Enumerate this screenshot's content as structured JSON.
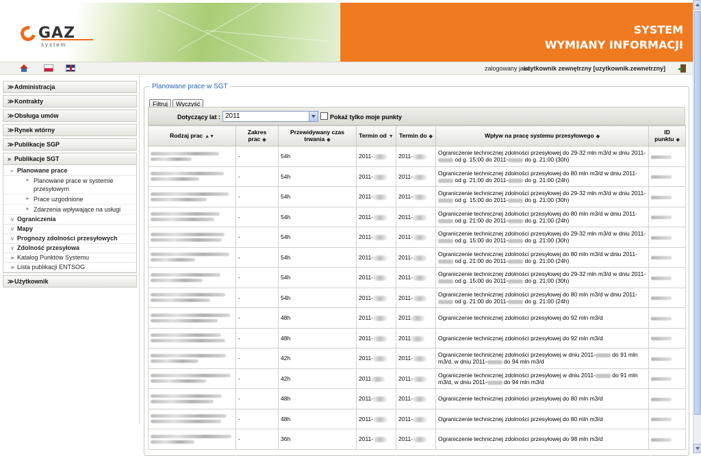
{
  "header": {
    "logo_text": "GAZ",
    "logo_sub": "system",
    "title_line1": "SYSTEM",
    "title_line2": "WYMIANY INFORMACJI",
    "accent": "#f07a20"
  },
  "topbar": {
    "icons": [
      "home-icon",
      "flag-pl-icon",
      "flag-uk-icon",
      "logout-icon"
    ],
    "login_label": "zalogowany jako:",
    "login_user": "użytkownik zewnętrzny [uzytkownik.zewnetrzny]"
  },
  "sidebar": {
    "items": [
      {
        "label": "Administracja"
      },
      {
        "label": "Kontrakty"
      },
      {
        "label": "Obsługa umów"
      },
      {
        "label": "Rynek wtórny"
      },
      {
        "label": "Publikacje SGP"
      },
      {
        "label": "Publikacje SGT"
      }
    ],
    "open_group": {
      "planowane": "Planowane prace",
      "planowane_children": [
        "Planowane prace w systemie przesyłowym",
        "Prace uzgodnione",
        "Zdarzenia wpływające na usługi"
      ],
      "ograniczenia": "Ograniczenia",
      "mapy": "Mapy",
      "prognozy": "Prognozy zdolności przesyłowych",
      "zdolnosc": "Zdolność przesyłowa",
      "katalog": "Katalog Punktów Systemu",
      "lista": "Lista publikacji ENTSOG"
    },
    "last_item": "Użytkownik"
  },
  "main": {
    "legend": "Planowane prace w SGT",
    "filter_button": "Filtruj",
    "clear_button": "Wyczyść",
    "year_label": "Dotyczący lat :",
    "year_value": "2011",
    "only_mine_label": "Pokaż tylko moje punkty",
    "only_mine_checked": false
  },
  "table": {
    "columns": [
      "Rodzaj prac",
      "Zakres prac",
      "Przewidywany czas trwania",
      "Termin od",
      "Termin do",
      "Wpływ na pracę systemu przesyłowego",
      "ID punktu"
    ],
    "sort_active": "Termin od",
    "rows": [
      {
        "zakres": "-",
        "czas": "54h",
        "od": "2011-",
        "do": "2011-",
        "wplyw": [
          "Ograniczenie technicznej zdolności przesyłowej do 29-32 mln m3/d w dniu",
          "2011-",
          " od g. 15:00 do 2011-",
          " do g. 21:00 (30h)"
        ]
      },
      {
        "zakres": "-",
        "czas": "54h",
        "od": "2011-",
        "do": "2011-",
        "wplyw": [
          "Ograniczenie technicznej zdolności przesyłowej do 80 mln m3/d w dniu 2011-",
          "",
          " od g. 21:00 do 2011-",
          " do g. 21:00 (24h)"
        ]
      },
      {
        "zakres": "-",
        "czas": "54h",
        "od": "2011-",
        "do": "2011-",
        "wplyw": [
          "Ograniczenie technicznej zdolności przesyłowej do 29-32 mln m3/d w dniu",
          "2011-",
          " od g. 15:00 do 2011-",
          " do g. 21:00 (30h)"
        ]
      },
      {
        "zakres": "-",
        "czas": "54h",
        "od": "2011-",
        "do": "2011-",
        "wplyw": [
          "Ograniczenie technicznej zdolności przesyłowej do 80 mln m3/d w dniu 2011-",
          "",
          " od g. 21:00 do 2011-",
          " do g. 21:00 (24h)"
        ]
      },
      {
        "zakres": "-",
        "czas": "54h",
        "od": "2011-",
        "do": "2011-",
        "wplyw": [
          "Ograniczenie technicznej zdolności przesyłowej do 29-32 mln m3/d w dniu",
          "2011-",
          " od g. 15:00 do 2011-",
          " do g. 21:00 (30h)"
        ]
      },
      {
        "zakres": "-",
        "czas": "54h",
        "od": "2011-",
        "do": "2011-",
        "wplyw": [
          "Ograniczenie technicznej zdolności przesyłowej do 80 mln m3/d w dniu 2011-",
          "",
          " od g. 21:00 do 2011-",
          " do g. 21:00 (24h)"
        ]
      },
      {
        "zakres": "-",
        "czas": "54h",
        "od": "2011-",
        "do": "2011-",
        "wplyw": [
          "Ograniczenie technicznej zdolności przesyłowej do 29-32 mln m3/d w dniu",
          "2011-",
          " od g. 15:00 do 2011-",
          " do g. 21:00 (30h)"
        ]
      },
      {
        "zakres": "-",
        "czas": "54h",
        "od": "2011-",
        "do": "2011-",
        "wplyw": [
          "Ograniczenie technicznej zdolności przesyłowej do 80 mln m3/d w dniu 2011-",
          "",
          " od g. 21:00 do 2011-",
          " do g. 21:00 (24h)"
        ]
      },
      {
        "zakres": "-",
        "czas": "48h",
        "od": "2011-",
        "do": "2011",
        "wplyw_simple": "Ograniczenie technicznej zdolności przesyłowej do 92 mln m3/d"
      },
      {
        "zakres": "-",
        "czas": "48h",
        "od": "2011-",
        "do": "2011",
        "wplyw_simple": "Ograniczenie technicznej zdolności przesyłowej do 92 mln m3/d"
      },
      {
        "zakres": "-",
        "czas": "42h",
        "od": "2011-",
        "do": "2011-",
        "wplyw2": [
          "Ograniczenie technicznej zdolności przesyłowej w dniu 2011-",
          " do 91 mln",
          "m3/d, w dniu 2011-",
          " do 94 mln m3/d"
        ]
      },
      {
        "zakres": "-",
        "czas": "42h",
        "od": "2011",
        "do": "2011-",
        "wplyw2": [
          "Ograniczenie technicznej zdolności przesyłowej w dniu 2011-",
          " do 91 mln",
          "m3/d, w dniu 2011-",
          " do 94 mln m3/d"
        ]
      },
      {
        "zakres": "-",
        "czas": "48h",
        "od": "2011-",
        "do": "2011-",
        "wplyw_simple": "Ograniczenie technicznej zdolności przesyłowej do 80 mln m3/d"
      },
      {
        "zakres": "-",
        "czas": "48h",
        "od": "2011-",
        "do": "2011-",
        "wplyw_simple": "Ograniczenie technicznej zdolności przesyłowej do 80 mln m3/d"
      },
      {
        "zakres": "-",
        "czas": "36h",
        "od": "2011-",
        "do": "2011-",
        "wplyw_simple": "Ograniczenie technicznej zdolności przesyłowej do 98 mln m3/d"
      }
    ]
  }
}
